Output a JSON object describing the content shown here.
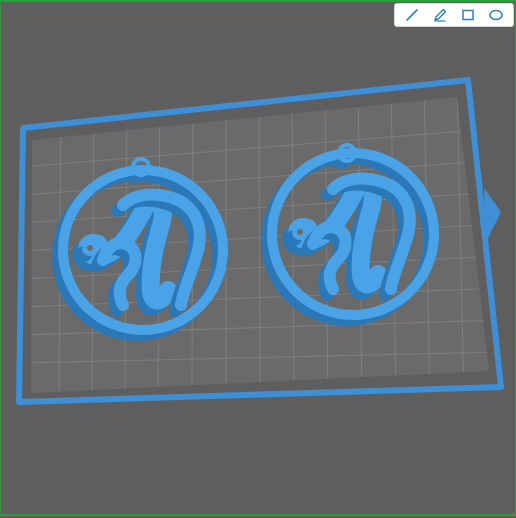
{
  "viewer": {
    "colors": {
      "background": "#5e5e5e",
      "grid_fill": "#6a6a6a",
      "grid_line": "#7e7e7e",
      "plate_border": "#3f8fd6",
      "model": "#4aa3e6",
      "model_shadow": "#2b78b8",
      "toolbar_icon": "#2f7fc5"
    },
    "toolbar": {
      "tools": [
        "line-tool",
        "pen-tool",
        "rectangle-tool",
        "ellipse-tool"
      ]
    },
    "models": [
      {
        "name": "earring-left",
        "letter": "M"
      },
      {
        "name": "earring-right",
        "letter": "M"
      }
    ]
  }
}
